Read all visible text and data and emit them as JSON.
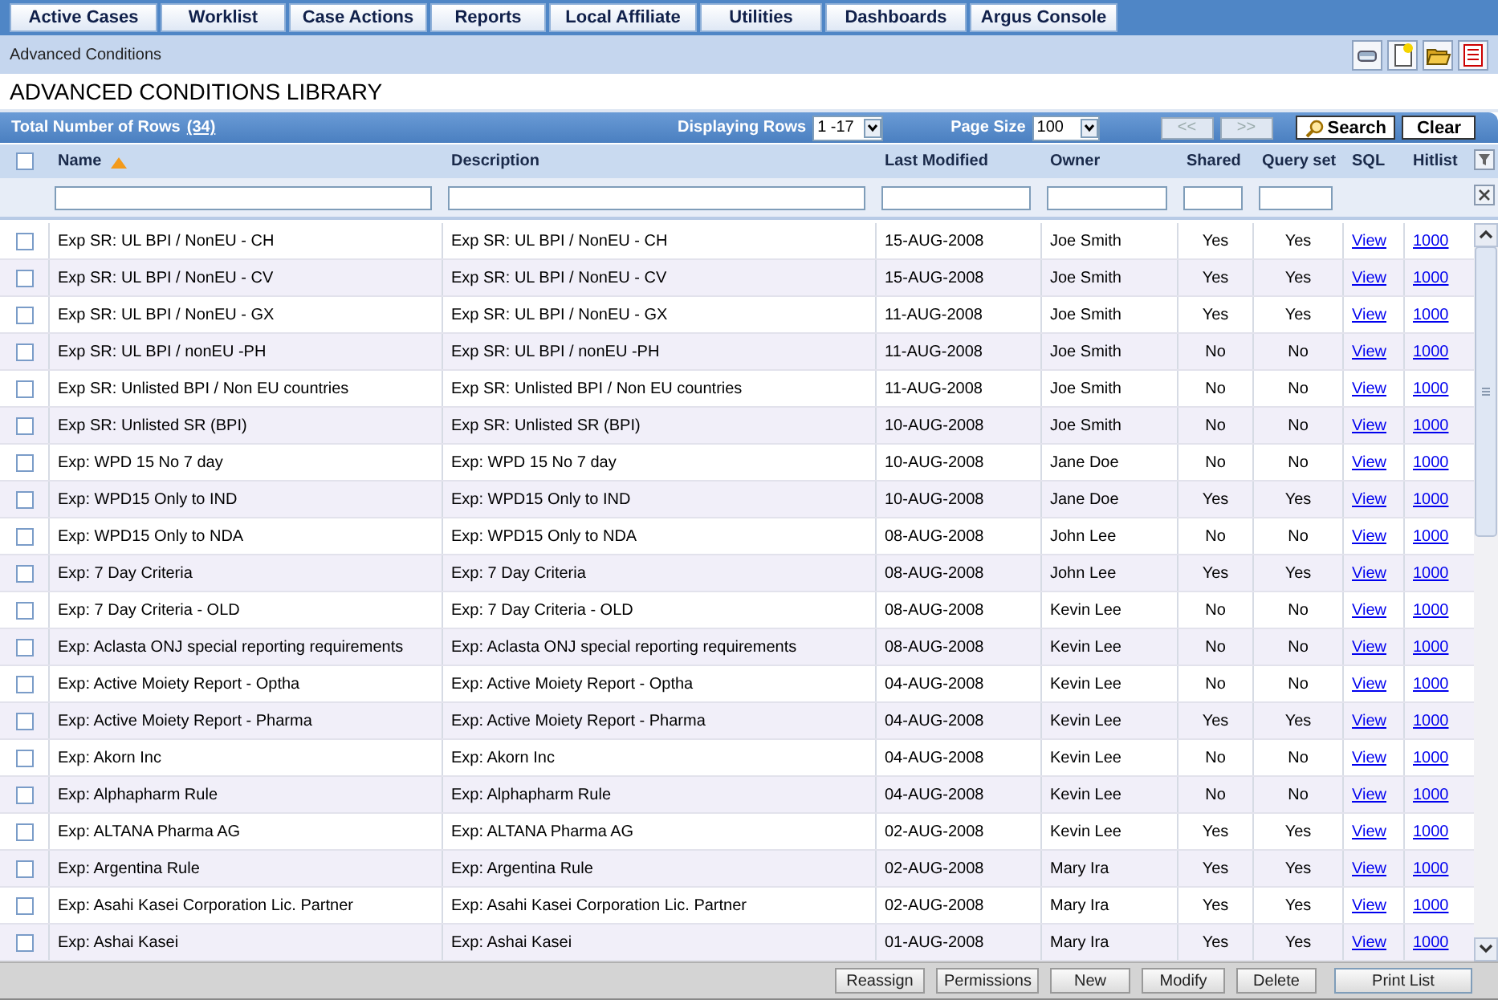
{
  "nav_tabs": [
    {
      "label": "Active Cases",
      "selected": false
    },
    {
      "label": "Worklist",
      "selected": false
    },
    {
      "label": "Case Actions",
      "selected": false
    },
    {
      "label": "Reports",
      "selected": false
    },
    {
      "label": "Local Affiliate",
      "selected": false
    },
    {
      "label": "Utilities",
      "selected": false
    },
    {
      "label": "Dashboards",
      "selected": false
    },
    {
      "label": "Argus Console",
      "selected": false
    }
  ],
  "breadcrumb": "Advanced Conditions",
  "page_title": "ADVANCED CONDITIONS LIBRARY",
  "toolbar": {
    "total_rows_label": "Total Number of Rows",
    "total_rows_count": "(34)",
    "displaying_rows_label": "Displaying Rows",
    "displaying_rows_value": "1 -17",
    "page_size_label": "Page Size",
    "page_size_value": "100",
    "pager": [
      {
        "label": "<<",
        "disabled": true
      },
      {
        "label": ">>",
        "disabled": true
      }
    ],
    "search_button": "Search",
    "clear_button": "Clear"
  },
  "select_all": {
    "checked": false
  },
  "columns": [
    {
      "label": "Name",
      "sorted_ascending": true,
      "filterable": true
    },
    {
      "label": "Description",
      "sorted_ascending": false,
      "filterable": true
    },
    {
      "label": "Last Modified",
      "sorted_ascending": false,
      "filterable": true
    },
    {
      "label": "Owner",
      "sorted_ascending": false,
      "filterable": true
    },
    {
      "label": "Shared",
      "sorted_ascending": false,
      "filterable": true
    },
    {
      "label": "Query set",
      "sorted_ascending": false,
      "filterable": true
    },
    {
      "label": "SQL",
      "sorted_ascending": false,
      "filterable": false
    },
    {
      "label": "Hitlist",
      "sorted_ascending": false,
      "filterable": false
    }
  ],
  "rows": [
    {
      "checked": false,
      "name": "Exp SR: UL BPI / NonEU - CH",
      "description": "Exp SR: UL BPI / NonEU - CH",
      "last_modified": "15-AUG-2008",
      "owner": "Joe Smith",
      "shared": "Yes",
      "query_set": "Yes",
      "sql": "View",
      "hitlist": "1000"
    },
    {
      "checked": false,
      "name": "Exp SR: UL BPI / NonEU - CV",
      "description": "Exp SR: UL BPI / NonEU - CV",
      "last_modified": "15-AUG-2008",
      "owner": "Joe Smith",
      "shared": "Yes",
      "query_set": "Yes",
      "sql": "View",
      "hitlist": "1000"
    },
    {
      "checked": false,
      "name": "Exp SR: UL BPI / NonEU - GX",
      "description": "Exp SR: UL BPI / NonEU - GX",
      "last_modified": "11-AUG-2008",
      "owner": "Joe Smith",
      "shared": "Yes",
      "query_set": "Yes",
      "sql": "View",
      "hitlist": "1000"
    },
    {
      "checked": false,
      "name": "Exp SR: UL BPI / nonEU -PH",
      "description": "Exp SR: UL BPI / nonEU -PH",
      "last_modified": "11-AUG-2008",
      "owner": "Joe Smith",
      "shared": "No",
      "query_set": "No",
      "sql": "View",
      "hitlist": "1000"
    },
    {
      "checked": false,
      "name": "Exp SR: Unlisted BPI / Non EU countries",
      "description": "Exp SR: Unlisted BPI / Non EU countries",
      "last_modified": "11-AUG-2008",
      "owner": "Joe Smith",
      "shared": "No",
      "query_set": "No",
      "sql": "View",
      "hitlist": "1000"
    },
    {
      "checked": false,
      "name": "Exp SR: Unlisted SR (BPI)",
      "description": "Exp SR: Unlisted SR (BPI)",
      "last_modified": "10-AUG-2008",
      "owner": "Joe Smith",
      "shared": "No",
      "query_set": "No",
      "sql": "View",
      "hitlist": "1000"
    },
    {
      "checked": false,
      "name": "Exp:  WPD 15 No 7 day",
      "description": "Exp:  WPD 15 No 7 day",
      "last_modified": "10-AUG-2008",
      "owner": "Jane Doe",
      "shared": "No",
      "query_set": "No",
      "sql": "View",
      "hitlist": "1000"
    },
    {
      "checked": false,
      "name": "Exp:  WPD15 Only to IND",
      "description": "Exp:  WPD15 Only to IND",
      "last_modified": "10-AUG-2008",
      "owner": "Jane Doe",
      "shared": "Yes",
      "query_set": "Yes",
      "sql": "View",
      "hitlist": "1000"
    },
    {
      "checked": false,
      "name": "Exp:  WPD15 Only to NDA",
      "description": "Exp:  WPD15 Only to NDA",
      "last_modified": "08-AUG-2008",
      "owner": "John Lee",
      "shared": "No",
      "query_set": "No",
      "sql": "View",
      "hitlist": "1000"
    },
    {
      "checked": false,
      "name": "Exp: 7 Day Criteria",
      "description": "Exp: 7 Day Criteria",
      "last_modified": "08-AUG-2008",
      "owner": "John Lee",
      "shared": "Yes",
      "query_set": "Yes",
      "sql": "View",
      "hitlist": "1000"
    },
    {
      "checked": false,
      "name": "Exp: 7 Day Criteria - OLD",
      "description": "Exp: 7 Day Criteria - OLD",
      "last_modified": "08-AUG-2008",
      "owner": "Kevin Lee",
      "shared": "No",
      "query_set": "No",
      "sql": "View",
      "hitlist": "1000"
    },
    {
      "checked": false,
      "name": "Exp: Aclasta ONJ special reporting requirements",
      "description": "Exp: Aclasta ONJ special reporting requirements",
      "last_modified": "08-AUG-2008",
      "owner": "Kevin Lee",
      "shared": "No",
      "query_set": "No",
      "sql": "View",
      "hitlist": "1000"
    },
    {
      "checked": false,
      "name": "Exp: Active Moiety Report - Optha",
      "description": "Exp: Active Moiety Report - Optha",
      "last_modified": "04-AUG-2008",
      "owner": "Kevin Lee",
      "shared": "No",
      "query_set": "No",
      "sql": "View",
      "hitlist": "1000"
    },
    {
      "checked": false,
      "name": "Exp: Active Moiety Report - Pharma",
      "description": "Exp: Active Moiety Report - Pharma",
      "last_modified": "04-AUG-2008",
      "owner": "Kevin Lee",
      "shared": "Yes",
      "query_set": "Yes",
      "sql": "View",
      "hitlist": "1000"
    },
    {
      "checked": false,
      "name": "Exp: Akorn Inc",
      "description": "Exp: Akorn Inc",
      "last_modified": "04-AUG-2008",
      "owner": "Kevin Lee",
      "shared": "No",
      "query_set": "No",
      "sql": "View",
      "hitlist": "1000"
    },
    {
      "checked": false,
      "name": "Exp: Alphapharm Rule",
      "description": "Exp: Alphapharm Rule",
      "last_modified": "04-AUG-2008",
      "owner": "Kevin Lee",
      "shared": "No",
      "query_set": "No",
      "sql": "View",
      "hitlist": "1000"
    },
    {
      "checked": false,
      "name": "Exp: ALTANA Pharma AG",
      "description": "Exp: ALTANA Pharma AG",
      "last_modified": "02-AUG-2008",
      "owner": "Kevin Lee",
      "shared": "Yes",
      "query_set": "Yes",
      "sql": "View",
      "hitlist": "1000"
    },
    {
      "checked": false,
      "name": "Exp: Argentina Rule",
      "description": "Exp: Argentina Rule",
      "last_modified": "02-AUG-2008",
      "owner": "Mary Ira",
      "shared": "Yes",
      "query_set": "Yes",
      "sql": "View",
      "hitlist": "1000"
    },
    {
      "checked": false,
      "name": "Exp: Asahi Kasei Corporation Lic. Partner",
      "description": "Exp: Asahi Kasei Corporation Lic. Partner",
      "last_modified": "02-AUG-2008",
      "owner": "Mary Ira",
      "shared": "Yes",
      "query_set": "Yes",
      "sql": "View",
      "hitlist": "1000"
    },
    {
      "checked": false,
      "name": "Exp: Ashai Kasei",
      "description": "Exp: Ashai Kasei",
      "last_modified": "01-AUG-2008",
      "owner": "Mary Ira",
      "shared": "Yes",
      "query_set": "Yes",
      "sql": "View",
      "hitlist": "1000"
    }
  ],
  "footer_buttons": [
    "Reassign",
    "Permissions",
    "New",
    "Modify",
    "Delete",
    "Print List"
  ]
}
